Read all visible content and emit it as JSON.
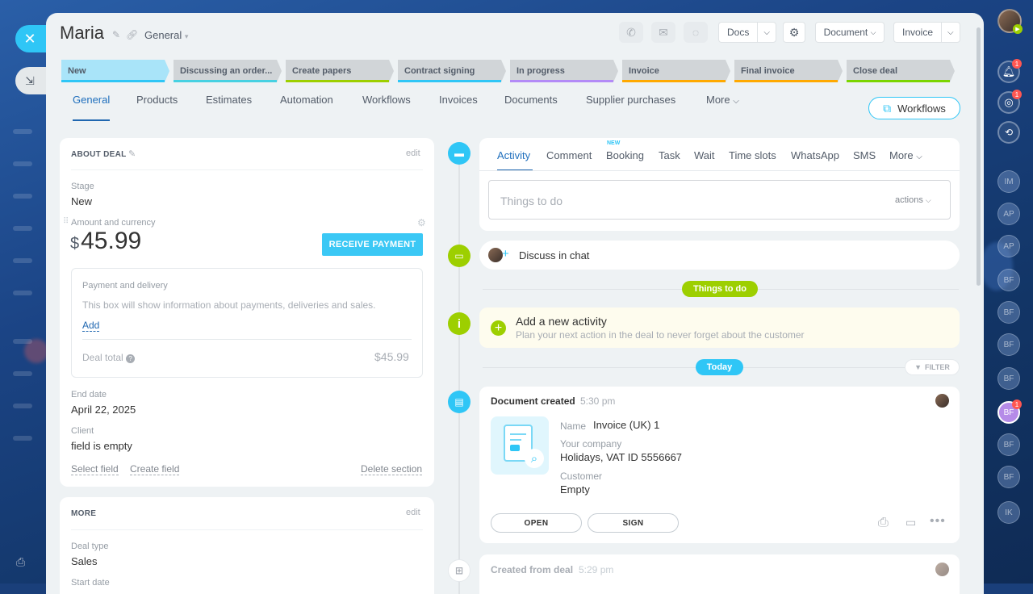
{
  "header": {
    "title": "Maria",
    "category": "General",
    "docs_label": "Docs",
    "document_label": "Document",
    "invoice_label": "Invoice"
  },
  "stages": [
    {
      "label": "New",
      "color": "#a9e4f9",
      "bar": "#2fc6f6"
    },
    {
      "label": "Discussing an order...",
      "color": "#d1d5d8",
      "bar": "#47d1e2"
    },
    {
      "label": "Create papers",
      "color": "#d1d5d8",
      "bar": "#9dcf00"
    },
    {
      "label": "Contract signing",
      "color": "#d1d5d8",
      "bar": "#2fc6f6"
    },
    {
      "label": "In progress",
      "color": "#d1d5d8",
      "bar": "#b38bf7"
    },
    {
      "label": "Invoice",
      "color": "#d1d5d8",
      "bar": "#ffa900"
    },
    {
      "label": "Final invoice",
      "color": "#d1d5d8",
      "bar": "#ffa900"
    },
    {
      "label": "Close deal",
      "color": "#d1d5d8",
      "bar": "#7bd500"
    }
  ],
  "tabs": [
    "General",
    "Products",
    "Estimates",
    "Automation",
    "Workflows",
    "Invoices",
    "Documents",
    "Supplier purchases",
    "More"
  ],
  "workflows_button": "Workflows",
  "about": {
    "title": "ABOUT DEAL",
    "edit": "edit",
    "stage_label": "Stage",
    "stage_value": "New",
    "amount_label": "Amount and currency",
    "amount_currency": "$",
    "amount_value": "45.99",
    "receive_payment": "RECEIVE PAYMENT",
    "payment_title": "Payment and delivery",
    "payment_text": "This box will show information about payments, deliveries and sales.",
    "payment_add": "Add",
    "deal_total_label": "Deal total",
    "deal_total_value": "$45.99",
    "end_date_label": "End date",
    "end_date_value": "April 22, 2025",
    "client_label": "Client",
    "client_value": "field is empty",
    "select_field": "Select field",
    "create_field": "Create field",
    "delete_section": "Delete section"
  },
  "more": {
    "title": "MORE",
    "edit": "edit",
    "deal_type_label": "Deal type",
    "deal_type_value": "Sales",
    "start_date_label": "Start date"
  },
  "activity": {
    "tabs": [
      "Activity",
      "Comment",
      "Booking",
      "Task",
      "Wait",
      "Time slots",
      "WhatsApp",
      "SMS",
      "More"
    ],
    "new_badge": "NEW",
    "placeholder": "Things to do",
    "actions": "actions",
    "discuss": "Discuss in chat",
    "things_to_do_pill": "Things to do",
    "add_title": "Add a new activity",
    "add_sub": "Plan your next action in the deal to never forget about the customer",
    "today_pill": "Today",
    "filter": "FILTER"
  },
  "doc_event": {
    "title": "Document created",
    "time": "5:30 pm",
    "name_label": "Name",
    "name_value": "Invoice (UK) 1",
    "company_label": "Your company",
    "company_value": "Holidays, VAT ID 5556667",
    "customer_label": "Customer",
    "customer_value": "Empty",
    "open": "OPEN",
    "sign": "SIGN"
  },
  "created_event": {
    "title": "Created from deal",
    "time": "5:29 pm"
  },
  "right_bar": {
    "avatars": [
      "IM",
      "AP",
      "AP",
      "BF",
      "BF",
      "BF",
      "BF",
      "BF",
      "BF",
      "BF",
      "IK"
    ]
  },
  "colors": {
    "accent": "#2fc6f6",
    "green": "#9dcf00",
    "link": "#2067b0"
  }
}
